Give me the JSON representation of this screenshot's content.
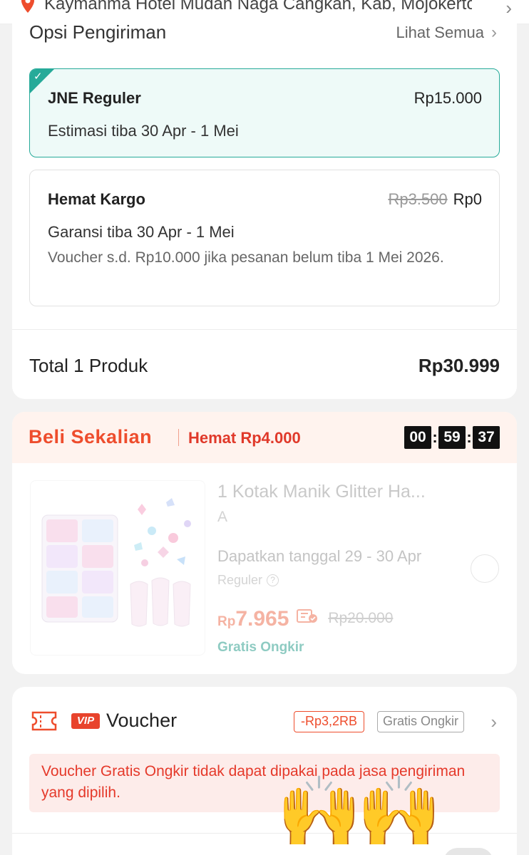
{
  "address": {
    "text": "Kaymanma Hotel Mudah Naga Cangkan, Kab, Mojokerto"
  },
  "shipping": {
    "title": "Opsi Pengiriman",
    "see_all": "Lihat Semua",
    "options": [
      {
        "name": "JNE Reguler",
        "price": "Rp15.000",
        "eta": "Estimasi tiba 30 Apr - 1 Mei",
        "selected": true
      },
      {
        "name": "Hemat Kargo",
        "price_original": "Rp3.500",
        "price": "Rp0",
        "guarantee": "Garansi tiba 30 Apr - 1 Mei",
        "voucher_note": "Voucher s.d.  Rp10.000 jika pesanan belum tiba 1 Mei 2026.",
        "selected": false
      }
    ],
    "total_label": "Total 1 Produk",
    "total_value": "Rp30.999"
  },
  "bundle": {
    "title": "Beli Sekalian",
    "saving": "Hemat Rp4.000",
    "timer": {
      "hours": "00",
      "minutes": "59",
      "seconds": "37"
    },
    "product": {
      "name": "1 Kotak Manik Glitter Ha...",
      "variant": "A",
      "delivery_date": "Dapatkan tanggal 29 - 30 Apr",
      "service": "Reguler",
      "price_currency": "Rp",
      "price": "7.965",
      "price_original": "Rp20.000",
      "free_shipping": "Gratis Ongkir"
    }
  },
  "voucher": {
    "vip_badge": "VIP",
    "label": "Voucher",
    "discount_chip": "-Rp3,2RB",
    "shipping_chip": "Gratis Ongkir",
    "warning": "Voucher Gratis Ongkir tidak dapat dipakai pada jasa pengiriman yang dipilih."
  },
  "decorations": {
    "emoji_left": "🙌",
    "emoji_right": "🙌"
  },
  "colors": {
    "accent": "#ee4d2d",
    "teal": "#26aa99",
    "warning_bg": "#fdecea"
  }
}
